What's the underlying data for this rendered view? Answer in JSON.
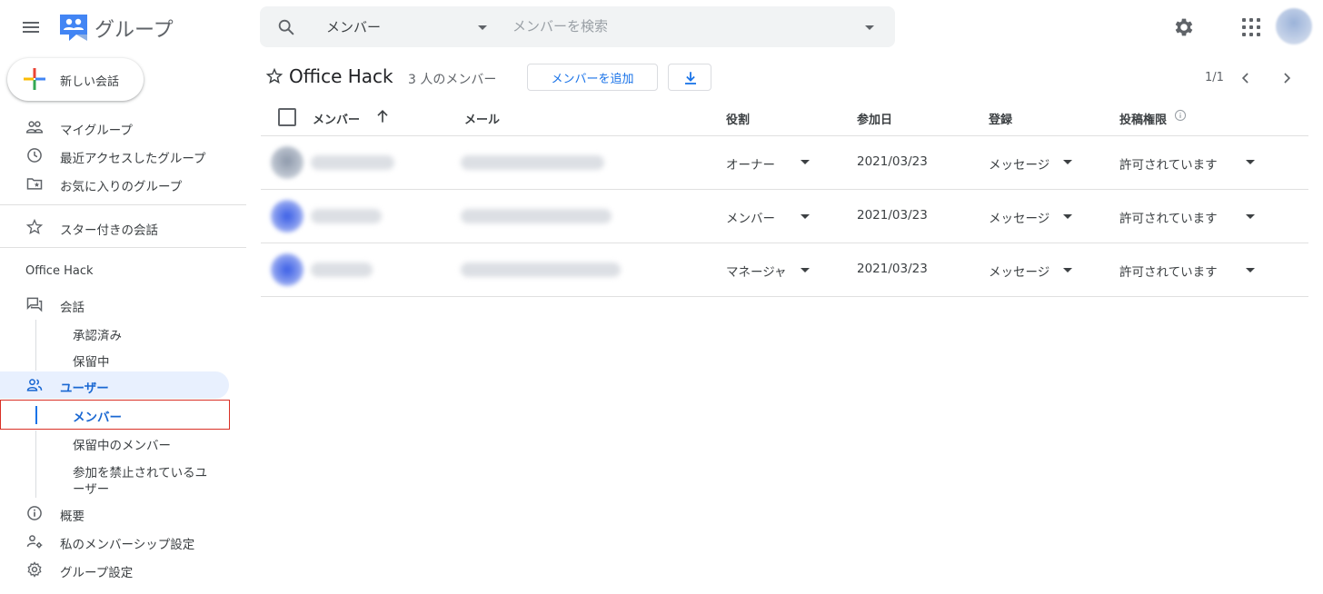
{
  "app": {
    "title": "グループ",
    "new_conversation": "新しい会話"
  },
  "search": {
    "scope": "メンバー",
    "placeholder": "メンバーを検索"
  },
  "sidebar": {
    "top_items": [
      {
        "label": "マイグループ",
        "icon": "people-icon"
      },
      {
        "label": "最近アクセスしたグループ",
        "icon": "clock-icon"
      },
      {
        "label": "お気に入りのグループ",
        "icon": "folder-star-icon"
      }
    ],
    "starred": {
      "label": "スター付きの会話",
      "icon": "star-icon"
    },
    "group_name": "Office Hack",
    "conversations": {
      "label": "会話",
      "icon": "forum-icon",
      "children": [
        "承認済み",
        "保留中"
      ]
    },
    "users": {
      "label": "ユーザー",
      "icon": "users-icon",
      "children": [
        "メンバー",
        "保留中のメンバー",
        "参加を禁止されているユ",
        "ーザー"
      ]
    },
    "bottom_items": [
      {
        "label": "概要",
        "icon": "info-icon"
      },
      {
        "label": "私のメンバーシップ設定",
        "icon": "person-settings-icon"
      },
      {
        "label": "グループ設定",
        "icon": "gear-icon"
      }
    ]
  },
  "header": {
    "group_title": "Office Hack",
    "member_count": "3 人のメンバー",
    "add_member": "メンバーを追加",
    "page_info": "1/1"
  },
  "table": {
    "columns": {
      "member": "メンバー",
      "email": "メール",
      "role": "役割",
      "joined": "参加日",
      "subscription": "登録",
      "posting": "投稿権限"
    },
    "rows": [
      {
        "role": "オーナー",
        "joined": "2021/03/23",
        "subscription": "メッセージ",
        "posting": "許可されています"
      },
      {
        "role": "メンバー",
        "joined": "2021/03/23",
        "subscription": "メッセージ",
        "posting": "許可されています"
      },
      {
        "role": "マネージャ",
        "joined": "2021/03/23",
        "subscription": "メッセージ",
        "posting": "許可されています"
      }
    ]
  },
  "colors": {
    "accent": "#1a73e8",
    "active_bg": "#e8f0fe",
    "highlight_border": "#d93025"
  }
}
